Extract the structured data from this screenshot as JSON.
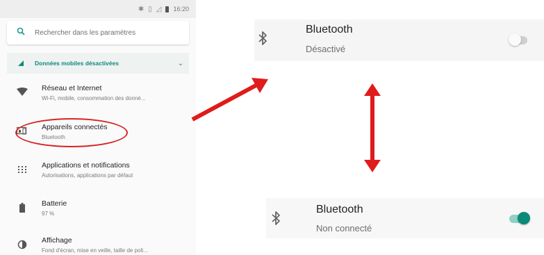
{
  "status_bar": {
    "bluetooth_glyph": "✱",
    "vibrate_glyph": "▯",
    "time": "16:20"
  },
  "search": {
    "placeholder": "Rechercher dans les paramètres",
    "icon": "search-icon"
  },
  "mobile_data": {
    "label": "Données mobiles désactivées",
    "icon": "signal-off-icon"
  },
  "settings_items": [
    {
      "title": "Réseau et Internet",
      "subtitle": "Wi-Fi, mobile, consommation des donné...",
      "icon": "wifi-icon"
    },
    {
      "title": "Appareils connectés",
      "subtitle": "Bluetooth",
      "icon": "connected-devices-icon"
    },
    {
      "title": "Applications et notifications",
      "subtitle": "Autorisations, applications par défaut",
      "icon": "apps-grid-icon"
    },
    {
      "title": "Batterie",
      "subtitle": "97 %",
      "icon": "battery-icon"
    },
    {
      "title": "Affichage",
      "subtitle": "Fond d'écran, mise en veille, taille de poli...",
      "icon": "brightness-icon"
    }
  ],
  "bluetooth_off": {
    "title": "Bluetooth",
    "status": "Désactivé",
    "toggle_on": false,
    "icon": "bluetooth-icon"
  },
  "bluetooth_on": {
    "title": "Bluetooth",
    "status": "Non connecté",
    "toggle_on": true,
    "icon": "bluetooth-icon"
  },
  "colors": {
    "accent": "#0e8a7c",
    "toggle_on_thumb": "#0b8a77",
    "toggle_on_track": "#8fd1c6",
    "toggle_off_thumb": "#fafafa",
    "toggle_off_track": "#c8c8c8",
    "annotation": "#e01b1b"
  }
}
